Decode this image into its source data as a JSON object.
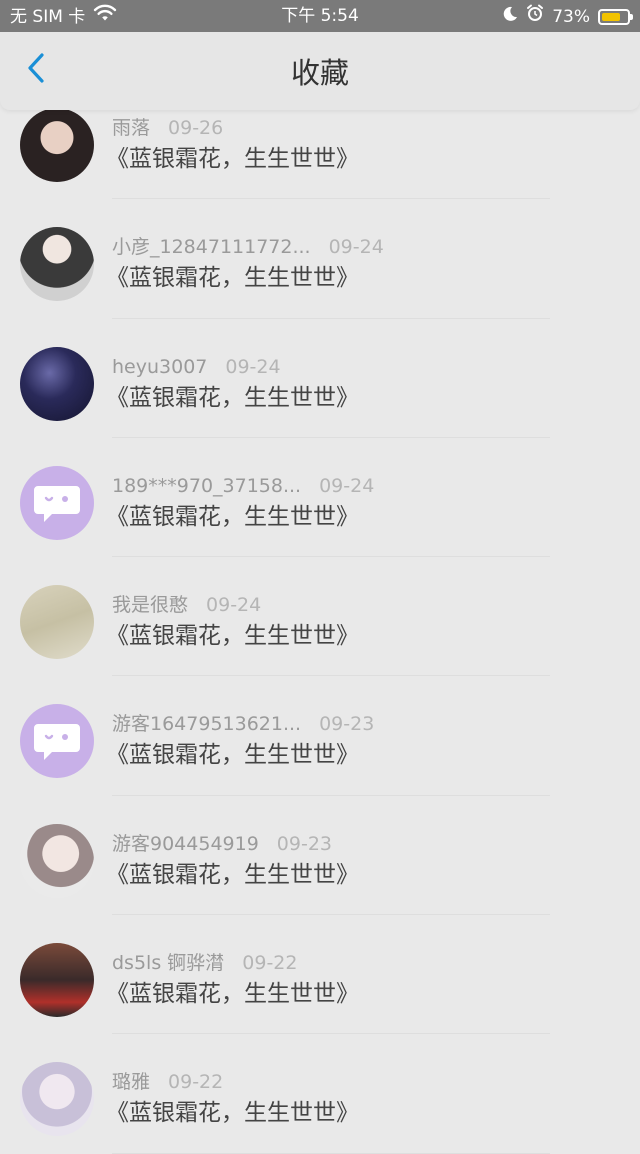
{
  "status_bar": {
    "carrier": "无 SIM 卡",
    "time": "下午 5:54",
    "battery_percent": "73%",
    "battery_level": 0.73,
    "battery_color": "#f2c300",
    "icons": [
      "wifi-icon",
      "moon-icon",
      "alarm-icon",
      "battery-icon"
    ]
  },
  "nav": {
    "title": "收藏",
    "back_icon": "chevron-left-icon",
    "accent": "#1a8fd6"
  },
  "favorites": [
    {
      "username": "雨落",
      "date": "09-26",
      "title": "《蓝银霜花，生生世世》",
      "avatar": "photo"
    },
    {
      "username": "小彦_12847111772...",
      "date": "09-24",
      "title": "《蓝银霜花，生生世世》",
      "avatar": "photo"
    },
    {
      "username": "heyu3007",
      "date": "09-24",
      "title": "《蓝银霜花，生生世世》",
      "avatar": "photo"
    },
    {
      "username": "189***970_37158...",
      "date": "09-24",
      "title": "《蓝银霜花，生生世世》",
      "avatar": "default"
    },
    {
      "username": "我是很憨",
      "date": "09-24",
      "title": "《蓝银霜花，生生世世》",
      "avatar": "photo"
    },
    {
      "username": "游客16479513621...",
      "date": "09-23",
      "title": "《蓝银霜花，生生世世》",
      "avatar": "default"
    },
    {
      "username": "游客904454919",
      "date": "09-23",
      "title": "《蓝银霜花，生生世世》",
      "avatar": "photo"
    },
    {
      "username": "ds5ls 锕骅潸",
      "date": "09-22",
      "title": "《蓝银霜花，生生世世》",
      "avatar": "photo"
    },
    {
      "username": "璐雅",
      "date": "09-22",
      "title": "《蓝银霜花，生生世世》",
      "avatar": "photo"
    }
  ]
}
